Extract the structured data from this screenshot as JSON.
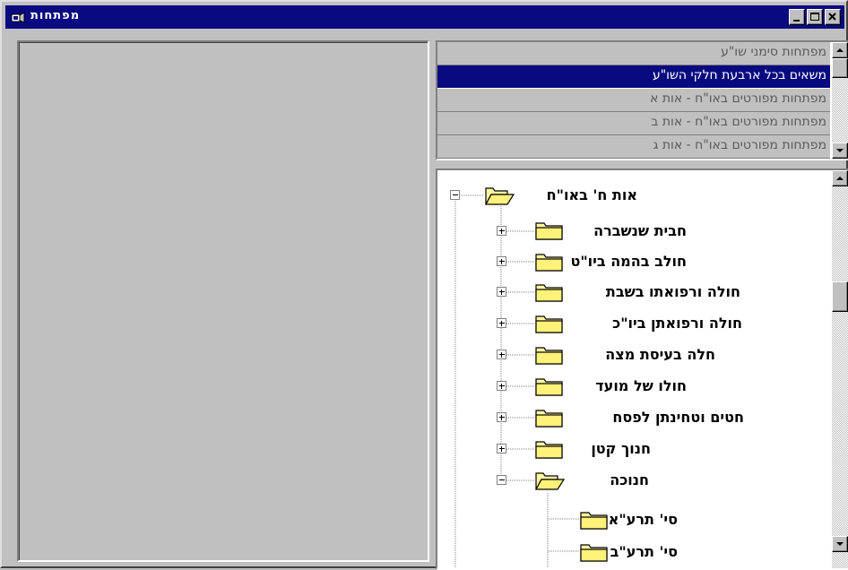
{
  "window": {
    "title": "מפתחות"
  },
  "list": {
    "items": [
      "מפתחות סימני שו\"ע",
      "משאים בכל ארבעת חלקי השו\"ע",
      "מפתחות מפורטים באו\"ח - אות א",
      "מפתחות מפורטים באו\"ח - אות ב",
      "מפתחות מפורטים באו\"ח - אות ג"
    ],
    "selected_index": 1
  },
  "tree": {
    "root": {
      "label": "אות ח' באו\"ח",
      "expanded": true
    },
    "children": [
      {
        "label": "חבית שנשברה",
        "expanded": false
      },
      {
        "label": "חולב בהמה ביו\"ט",
        "expanded": false
      },
      {
        "label": "חולה ורפואתו בשבת",
        "expanded": false
      },
      {
        "label": "חולה ורפואתן ביו\"כ",
        "expanded": false
      },
      {
        "label": "חלה בעיסת מצה",
        "expanded": false
      },
      {
        "label": "חולו של מועד",
        "expanded": false
      },
      {
        "label": "חטים וטחינתן לפסח",
        "expanded": false
      },
      {
        "label": "חנוך קטן",
        "expanded": false
      },
      {
        "label": "חנוכה",
        "expanded": true
      }
    ],
    "grandchildren": [
      {
        "label": "סי' תרע\"א"
      },
      {
        "label": "סי' תרע\"ב"
      }
    ]
  },
  "colors": {
    "titlebar": "#0a0a80",
    "selection": "#0a0a80",
    "face": "#c0c0c0",
    "folder": "#fff8a0"
  },
  "icons": {
    "title_icon": "app-icon",
    "minimize": "minimize-icon",
    "maximize": "maximize-icon",
    "close": "close-icon",
    "folder_closed": "folder-icon",
    "folder_open": "folder-open-icon",
    "plus": "plus-box-icon",
    "minus": "minus-box-icon",
    "scroll_up": "arrow-up-icon",
    "scroll_down": "arrow-down-icon"
  }
}
